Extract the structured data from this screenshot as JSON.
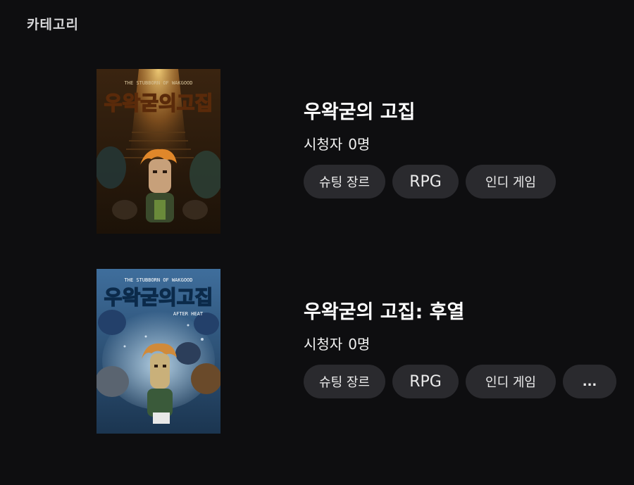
{
  "category": {
    "title": "카테고리"
  },
  "games": [
    {
      "title": "우왁굳의 고집",
      "viewer_label": "시청자",
      "viewer_count": "0명",
      "cover_logo_text": "우왁굳의고집",
      "cover_subtitle_text": "THE STUBBORN OF WAKGOOD",
      "tags": [
        "슈팅 장르",
        "RPG",
        "인디 게임"
      ]
    },
    {
      "title": "우왁굳의 고집: 후열",
      "viewer_label": "시청자",
      "viewer_count": "0명",
      "cover_logo_text": "우왁굳의고집",
      "cover_subtitle_text": "THE STUBBORN OF WAKGOOD",
      "cover_tagline_text": "AFTER HEAT",
      "tags": [
        "슈팅 장르",
        "RPG",
        "인디 게임"
      ],
      "more_label": "..."
    }
  ],
  "colors": {
    "background": "#0e0e10",
    "tag_background": "#2a2a2e",
    "cover1_logo": "#d9792e",
    "cover2_logo": "#4aa3e8"
  }
}
